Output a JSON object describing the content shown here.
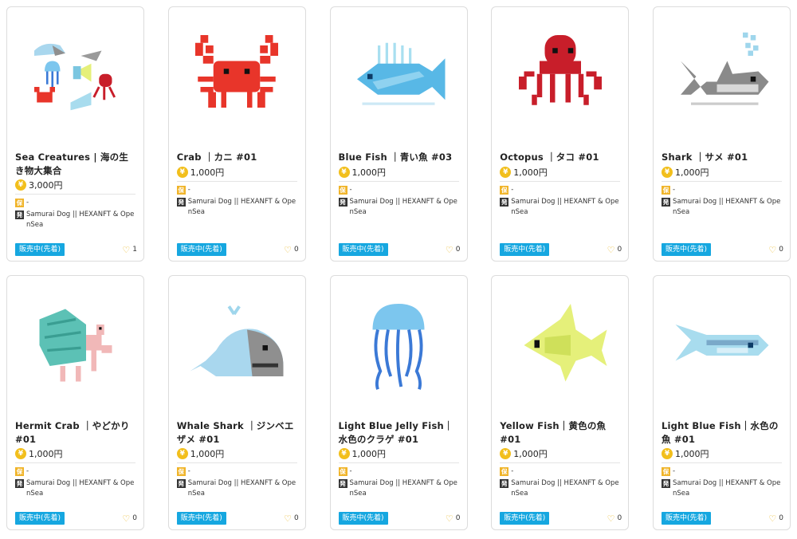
{
  "currency_symbol": "¥",
  "cards": [
    {
      "title": "Sea Creatures | 海の生き物大集合",
      "price": "3,000円",
      "holder": "-",
      "issuer": "Samurai Dog || HEXANFT & OpenSea",
      "status": "販売中(先着)",
      "likes": "1",
      "hold_tag": "保",
      "issuer_tag": "発",
      "art": "sea-creatures"
    },
    {
      "title": "Crab ｜カニ #01",
      "price": "1,000円",
      "holder": "-",
      "issuer": "Samurai Dog || HEXANFT & OpenSea",
      "status": "販売中(先着)",
      "likes": "0",
      "hold_tag": "保",
      "issuer_tag": "発",
      "art": "crab"
    },
    {
      "title": "Blue Fish ｜青い魚 #03",
      "price": "1,000円",
      "holder": "-",
      "issuer": "Samurai Dog || HEXANFT & OpenSea",
      "status": "販売中(先着)",
      "likes": "0",
      "hold_tag": "保",
      "issuer_tag": "発",
      "art": "blue-fish"
    },
    {
      "title": "Octopus ｜タコ #01",
      "price": "1,000円",
      "holder": "-",
      "issuer": "Samurai Dog || HEXANFT & OpenSea",
      "status": "販売中(先着)",
      "likes": "0",
      "hold_tag": "保",
      "issuer_tag": "発",
      "art": "octopus"
    },
    {
      "title": "Shark ｜サメ #01",
      "price": "1,000円",
      "holder": "-",
      "issuer": "Samurai Dog || HEXANFT & OpenSea",
      "status": "販売中(先着)",
      "likes": "0",
      "hold_tag": "保",
      "issuer_tag": "発",
      "art": "shark"
    },
    {
      "title": "Hermit Crab ｜やどかり #01",
      "price": "1,000円",
      "holder": "-",
      "issuer": "Samurai Dog || HEXANFT & OpenSea",
      "status": "販売中(先着)",
      "likes": "0",
      "hold_tag": "保",
      "issuer_tag": "発",
      "art": "hermit-crab"
    },
    {
      "title": "Whale Shark ｜ジンベエザメ #01",
      "price": "1,000円",
      "holder": "-",
      "issuer": "Samurai Dog || HEXANFT & OpenSea",
      "status": "販売中(先着)",
      "likes": "0",
      "hold_tag": "保",
      "issuer_tag": "発",
      "art": "whale-shark"
    },
    {
      "title": "Light Blue Jelly Fish｜水色のクラゲ #01",
      "price": "1,000円",
      "holder": "-",
      "issuer": "Samurai Dog || HEXANFT & OpenSea",
      "status": "販売中(先着)",
      "likes": "0",
      "hold_tag": "保",
      "issuer_tag": "発",
      "art": "jellyfish"
    },
    {
      "title": "Yellow Fish｜黄色の魚 #01",
      "price": "1,000円",
      "holder": "-",
      "issuer": "Samurai Dog || HEXANFT & OpenSea",
      "status": "販売中(先着)",
      "likes": "0",
      "hold_tag": "保",
      "issuer_tag": "発",
      "art": "yellow-fish"
    },
    {
      "title": "Light Blue Fish｜水色の魚 #01",
      "price": "1,000円",
      "holder": "-",
      "issuer": "Samurai Dog || HEXANFT & OpenSea",
      "status": "販売中(先着)",
      "likes": "0",
      "hold_tag": "保",
      "issuer_tag": "発",
      "art": "light-blue-fish"
    }
  ],
  "colors": {
    "status_bg": "#16a7e0",
    "yen_badge": "#f2bf1c",
    "heart": "#e9b82a",
    "hold_tag": "#f0b429",
    "issuer_tag": "#333333"
  }
}
